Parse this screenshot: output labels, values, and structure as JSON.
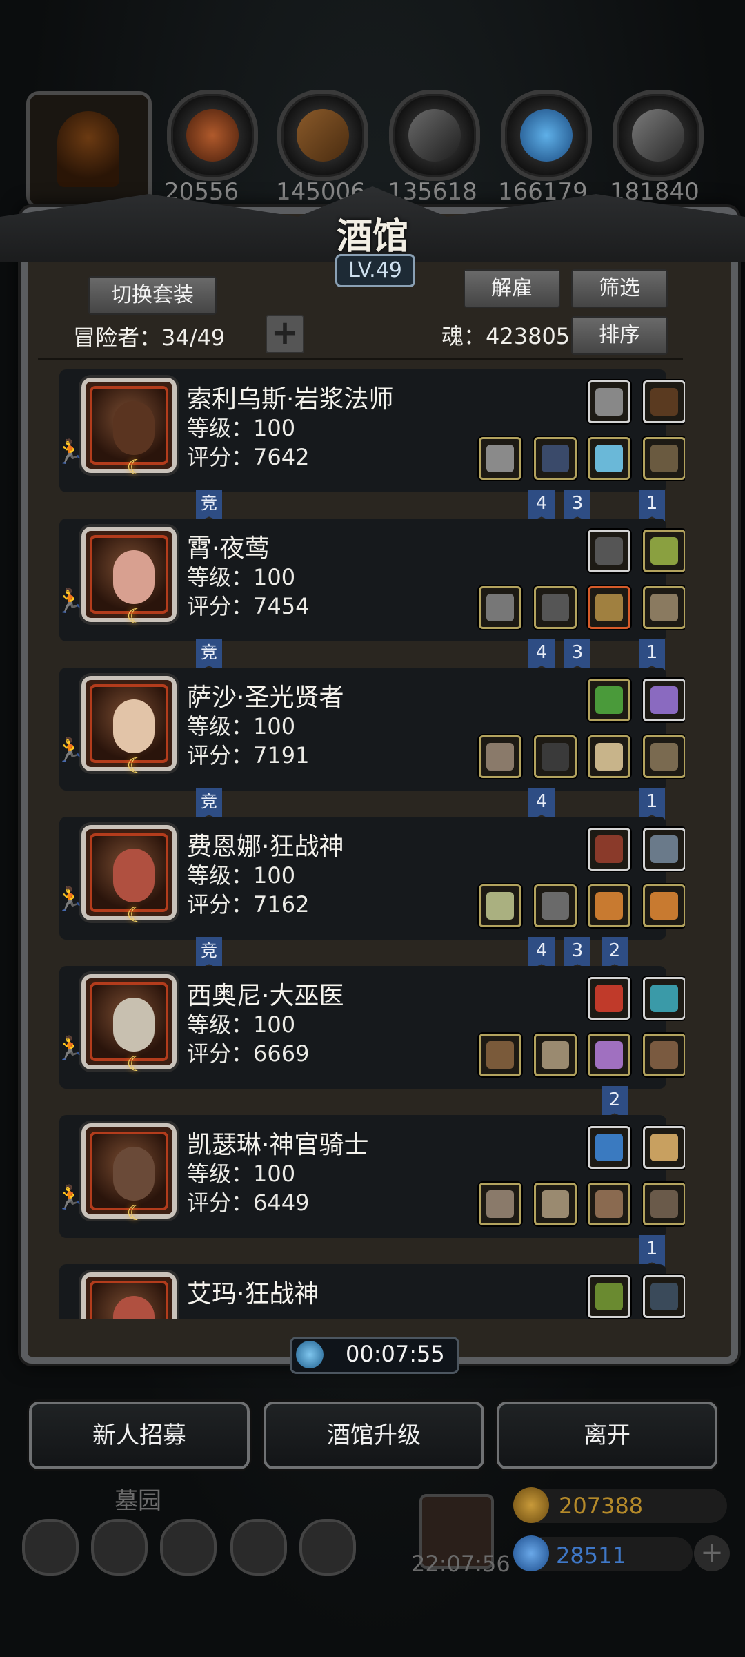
{
  "resources": [
    {
      "name": "meat",
      "value": "20556"
    },
    {
      "name": "wood",
      "value": "145006"
    },
    {
      "name": "stone",
      "value": "135618"
    },
    {
      "name": "crystal",
      "value": "166179"
    },
    {
      "name": "iron",
      "value": "181840"
    }
  ],
  "tavern": {
    "title": "酒馆",
    "level": "LV.49",
    "switch_outfit": "切换套装",
    "dismiss": "解雇",
    "filter": "筛选",
    "sort": "排序",
    "adventurers_label": "冒险者：34/49",
    "soul_label": "魂：423805",
    "add_icon": "plus-icon"
  },
  "adventurers": [
    {
      "name": "索利乌斯·岩浆法师",
      "level": "等级：100",
      "score": "评分：7642",
      "badge": "竞",
      "tags": [
        "4",
        "3",
        "1"
      ]
    },
    {
      "name": "霄·夜莺",
      "level": "等级：100",
      "score": "评分：7454",
      "badge": "竞",
      "tags": [
        "4",
        "3",
        "1"
      ]
    },
    {
      "name": "萨沙·圣光贤者",
      "level": "等级：100",
      "score": "评分：7191",
      "badge": "竞",
      "tags": [
        "4",
        "1"
      ]
    },
    {
      "name": "费恩娜·狂战神",
      "level": "等级：100",
      "score": "评分：7162",
      "badge": "竞",
      "tags": [
        "4",
        "3",
        "2"
      ]
    },
    {
      "name": "西奥尼·大巫医",
      "level": "等级：100",
      "score": "评分：6669",
      "badge": "",
      "tags": [
        "2"
      ]
    },
    {
      "name": "凯瑟琳·神官骑士",
      "level": "等级：100",
      "score": "评分：6449",
      "badge": "",
      "tags": [
        "1"
      ]
    },
    {
      "name": "艾玛·狂战神",
      "level": "",
      "score": "",
      "badge": "",
      "tags": []
    }
  ],
  "timer": "00:07:55",
  "buttons": {
    "recruit": "新人招募",
    "upgrade": "酒馆升级",
    "leave": "离开"
  },
  "bottom": {
    "graveyard": "墓园",
    "gift_timer": "22:07:56",
    "gold": "207388",
    "gems": "28511"
  },
  "colors": {
    "panel": "#2a2620",
    "card": "#16191c",
    "tag_blue": "#2e4d84",
    "gold_text": "#b58a2a",
    "gem_text": "#3f78c8"
  }
}
